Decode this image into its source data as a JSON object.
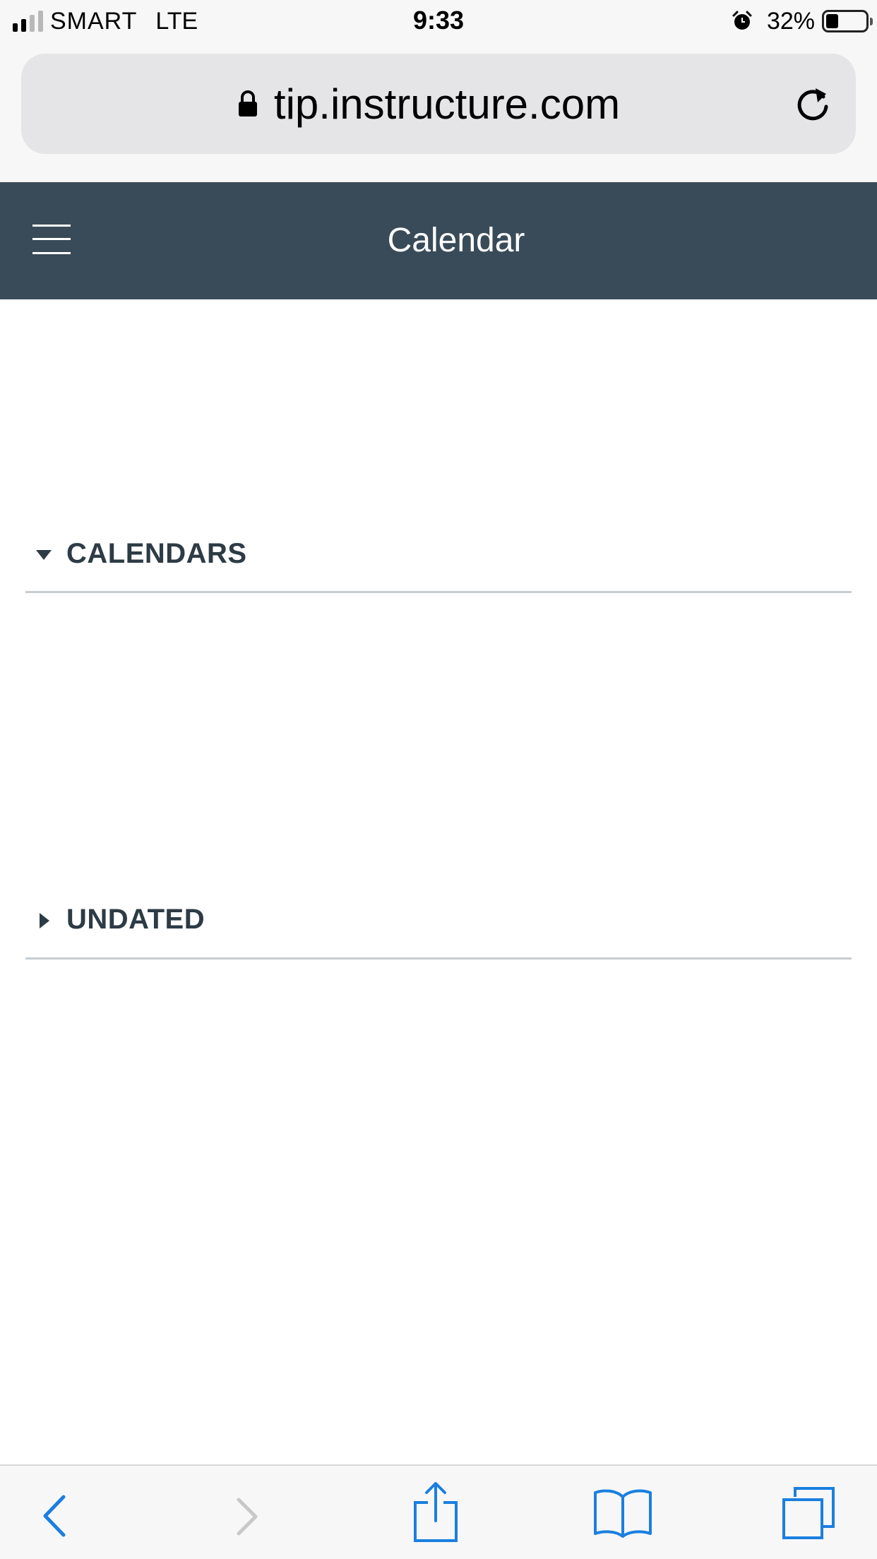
{
  "status_bar": {
    "carrier": "SMART",
    "network": "LTE",
    "time": "9:33",
    "battery_percent_text": "32%",
    "battery_level": 0.32,
    "icons": [
      "signal-icon",
      "alarm-icon",
      "battery-icon"
    ]
  },
  "browser": {
    "url": "tip.instructure.com",
    "icons": [
      "lock-icon",
      "reload-icon"
    ]
  },
  "header": {
    "title": "Calendar",
    "menu_icon": "hamburger-menu-icon",
    "background": "#394b58"
  },
  "sections": [
    {
      "label": "CALENDARS",
      "expanded": true,
      "icon": "caret-down-icon"
    },
    {
      "label": "UNDATED",
      "expanded": false,
      "icon": "caret-right-icon"
    }
  ],
  "toolbar": {
    "icons": [
      "back-icon",
      "forward-icon",
      "share-icon",
      "bookmarks-icon",
      "tabs-icon"
    ],
    "accent": "#1a7fe0",
    "disabled": "#c8c8c8"
  },
  "colors": {
    "section_text": "#2d3b45",
    "divider": "#c7cdd1"
  }
}
